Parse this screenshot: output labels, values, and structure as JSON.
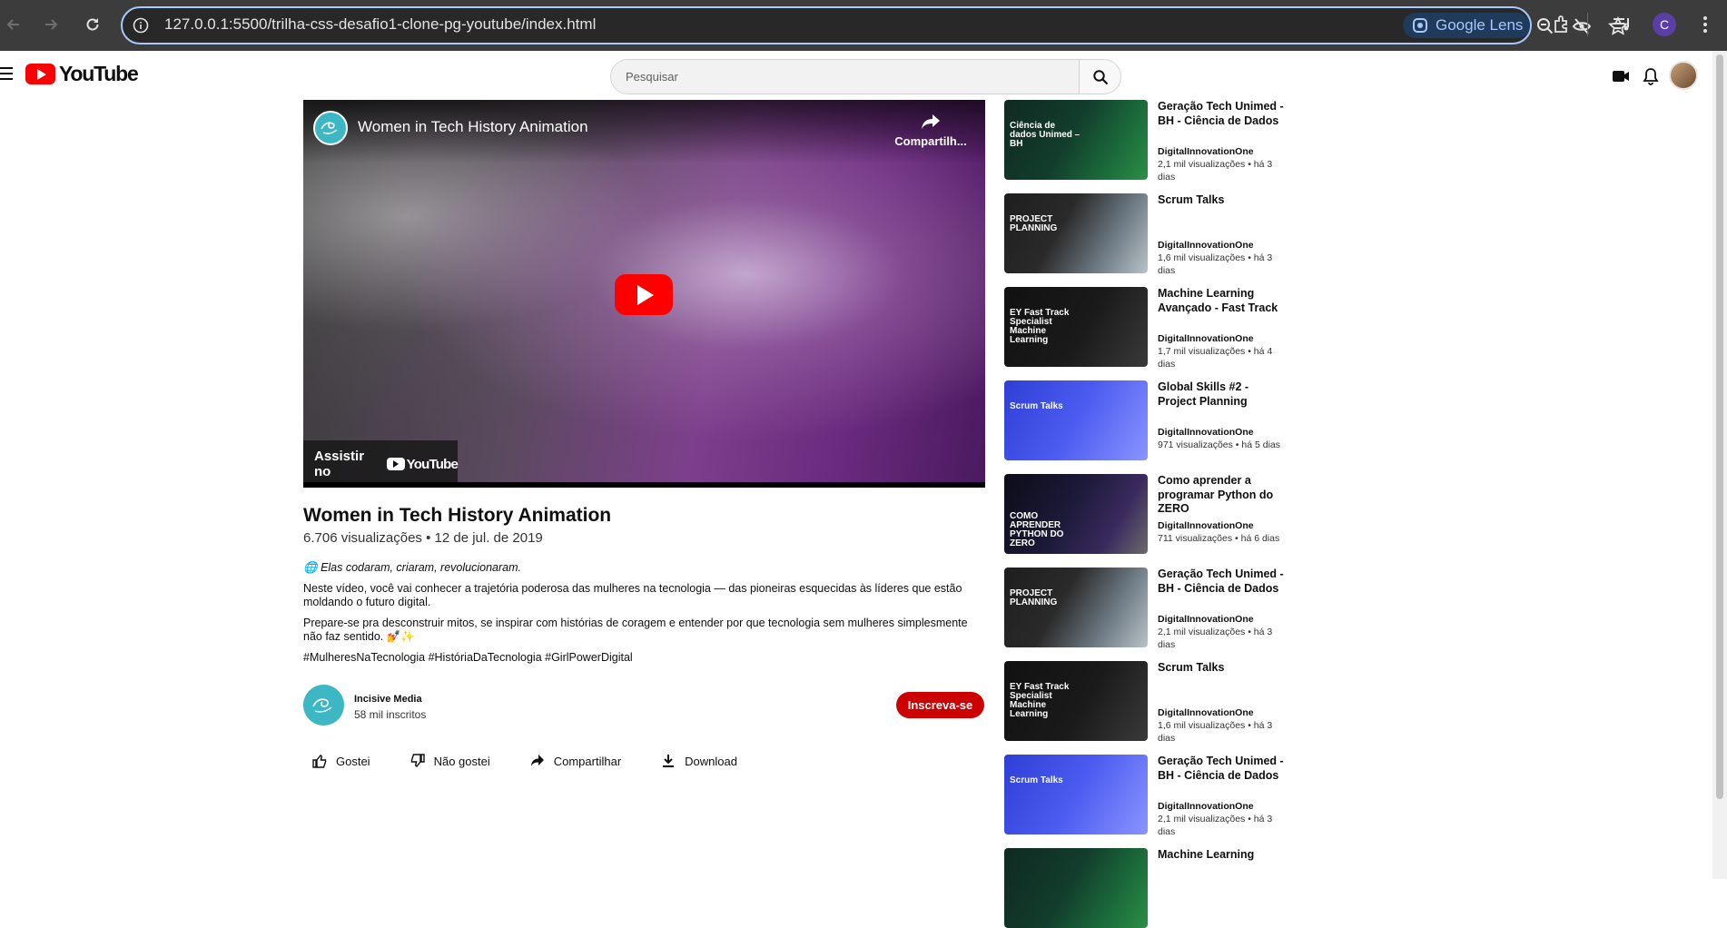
{
  "browser": {
    "url_host": "127.0.0.1",
    "url_path": ":5500/trilha-css-desafio1-clone-pg-youtube/index.html",
    "lens_label": "Google Lens",
    "profile_initial": "C"
  },
  "header": {
    "logo_text": "YouTube",
    "search_placeholder": "Pesquisar"
  },
  "player": {
    "overlay_title": "Women in Tech History Animation",
    "share_label": "Compartilh...",
    "watch_on_label": "Assistir no",
    "watch_on_brand": "YouTube"
  },
  "video": {
    "title": "Women in Tech History Animation",
    "meta": "6.706 visualizações • 12 de jul. de 2019",
    "tagline_icon": "🌐",
    "tagline": "Elas codaram, criaram, revolucionaram.",
    "paragraph1": "Neste vídeo, você vai conhecer a trajetória poderosa das mulheres na tecnologia — das pioneiras esquecidas às líderes que estão moldando o futuro digital.",
    "paragraph2": "Prepare-se pra desconstruir mitos, se inspirar com histórias de coragem e entender por que tecnologia sem mulheres simplesmente não faz sentido. 💅✨",
    "hashtags": "#MulheresNaTecnologia #HistóriaDaTecnologia #GirlPowerDigital"
  },
  "channel": {
    "name": "Incisive Media",
    "subscribers": "58 mil inscritos",
    "subscribe_label": "Inscreva-se"
  },
  "actions": {
    "like": "Gostei",
    "dislike": "Não gostei",
    "share": "Compartilhar",
    "download": "Download"
  },
  "recommendations": [
    {
      "title": "Geração Tech Unimed - BH - Ciência de Dados",
      "channel": "DigitalInnovationOne",
      "stats": "2,1 mil visualizações • há 3 dias",
      "thumb_text": "Ciência de dados Unimed – BH",
      "thumb_style": "green"
    },
    {
      "title": "Scrum Talks",
      "channel": "DigitalInnovationOne",
      "stats": "1,6 mil visualizações • há 3 dias",
      "thumb_text": "PROJECT PLANNING",
      "thumb_style": "planning"
    },
    {
      "title": "Machine Learning Avançado - Fast Track",
      "channel": "DigitalInnovationOne",
      "stats": "1,7 mil visualizações • há 4 dias",
      "thumb_text": "EY Fast Track Specialist Machine Learning",
      "thumb_style": "ey"
    },
    {
      "title": "Global Skills #2 - Project Planning",
      "channel": "DigitalInnovationOne",
      "stats": "971 visualizações • há 5 dias",
      "thumb_text": "Scrum Talks",
      "thumb_style": "scrum"
    },
    {
      "title": "Como aprender a programar Python do ZERO",
      "channel": "DigitalInnovationOne",
      "stats": "711 visualizações • há 6 dias",
      "thumb_text": "COMO APRENDER PYTHON DO ZERO",
      "thumb_style": "python"
    },
    {
      "title": "Geração Tech Unimed - BH - Ciência de Dados",
      "channel": "DigitalInnovationOne",
      "stats": "2,1 mil visualizações • há 3 dias",
      "thumb_text": "PROJECT PLANNING",
      "thumb_style": "planning"
    },
    {
      "title": "Scrum Talks",
      "channel": "DigitalInnovationOne",
      "stats": "1,6 mil visualizações • há 3 dias",
      "thumb_text": "EY Fast Track Specialist Machine Learning",
      "thumb_style": "ey"
    },
    {
      "title": "Geração Tech Unimed - BH - Ciência de Dados",
      "channel": "DigitalInnovationOne",
      "stats": "2,1 mil visualizações • há 3 dias",
      "thumb_text": "Scrum Talks",
      "thumb_style": "scrum"
    },
    {
      "title": "Machine Learning",
      "channel": "",
      "stats": "",
      "thumb_text": "",
      "thumb_style": "green"
    }
  ]
}
